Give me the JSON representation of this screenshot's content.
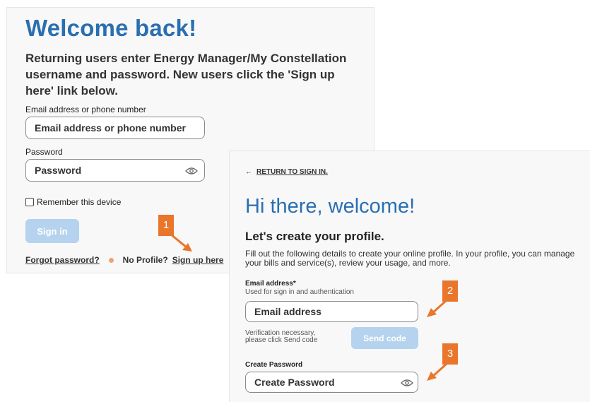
{
  "signin": {
    "title": "Welcome back!",
    "intro": "Returning users enter Energy Manager/My Constellation username and password. New users click the 'Sign up here' link below.",
    "email_label": "Email address or phone number",
    "email_placeholder": "Email address or phone number",
    "password_label": "Password",
    "password_placeholder": "Password",
    "remember_label": "Remember this device",
    "signin_button": "Sign in",
    "forgot_password": "Forgot password?",
    "no_profile": "No Profile?",
    "signup_link": "Sign up here"
  },
  "signup": {
    "return_arrow": "←",
    "return_link": "RETURN TO SIGN IN.",
    "title": "Hi there, welcome!",
    "subtitle": "Let's create your profile.",
    "description": "Fill out the following details to create your online profile. In your profile, you can manage your bills and service(s), review your usage, and more.",
    "email_label": "Email address*",
    "email_hint": "Used for sign in and authentication",
    "email_placeholder": "Email address",
    "verify_line1": "Verification necessary,",
    "verify_line2": "please click Send code",
    "send_code_button": "Send code",
    "password_label": "Create Password",
    "password_placeholder": "Create Password"
  },
  "callouts": {
    "one": "1",
    "two": "2",
    "three": "3"
  },
  "colors": {
    "accent_blue": "#2a6fb0",
    "disabled_button": "#b5d3ee",
    "callout_orange": "#e9762b",
    "separator_dot": "#f1a170"
  },
  "icons": {
    "password_toggle": "eye-icon",
    "return": "arrow-left-icon",
    "callout_arrow": "arrow-icon"
  }
}
